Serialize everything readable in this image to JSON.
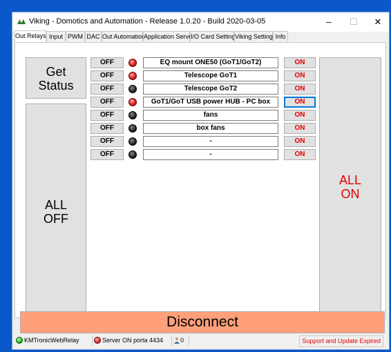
{
  "window": {
    "title": "Viking - Domotics and Automation - Release 1.0.20 - Build 2020-03-05",
    "minimize_glyph": "–",
    "maximize_glyph": "☐",
    "close_glyph": "✕"
  },
  "tabs": [
    {
      "label": "Out Relays"
    },
    {
      "label": "Input"
    },
    {
      "label": "PWM"
    },
    {
      "label": "DAC"
    },
    {
      "label": "Out Automation"
    },
    {
      "label": "Application Server"
    },
    {
      "label": "I/O Card Setting"
    },
    {
      "label": "Viking Setting"
    },
    {
      "label": "Info"
    }
  ],
  "active_tab": "Out Relays",
  "get_status": {
    "line1": "Get",
    "line2": "Status"
  },
  "all_off": {
    "line1": "ALL",
    "line2": "OFF"
  },
  "all_on": {
    "line1": "ALL",
    "line2": "ON"
  },
  "relays": [
    {
      "off_label": "OFF",
      "led": "red",
      "name": "EQ mount ONE50 (GoT1/GoT2)",
      "on_label": "ON"
    },
    {
      "off_label": "OFF",
      "led": "red",
      "name": "Telescope GoT1",
      "on_label": "ON"
    },
    {
      "off_label": "OFF",
      "led": "off",
      "name": "Telescope GoT2",
      "on_label": "ON"
    },
    {
      "off_label": "OFF",
      "led": "red",
      "name": "GoT1/GoT USB power HUB - PC box",
      "on_label": "ON"
    },
    {
      "off_label": "OFF",
      "led": "off",
      "name": "fans",
      "on_label": "ON"
    },
    {
      "off_label": "OFF",
      "led": "off",
      "name": "box fans",
      "on_label": "ON"
    },
    {
      "off_label": "OFF",
      "led": "off",
      "name": "-",
      "on_label": "ON"
    },
    {
      "off_label": "OFF",
      "led": "off",
      "name": "-",
      "on_label": "ON"
    }
  ],
  "disconnect_label": "Disconnect",
  "status_bar": {
    "relay_status": "KMTronicWebRelay",
    "server_status": "Server ON porta 4434",
    "users_count": "0",
    "support": "Support and Update Expired"
  },
  "colors": {
    "desktop": "#0a58c9",
    "disconnect_bg": "#ffa07a",
    "on_text": "#e00000",
    "led_red": "#e53030",
    "led_off": "#2a2a2a"
  }
}
